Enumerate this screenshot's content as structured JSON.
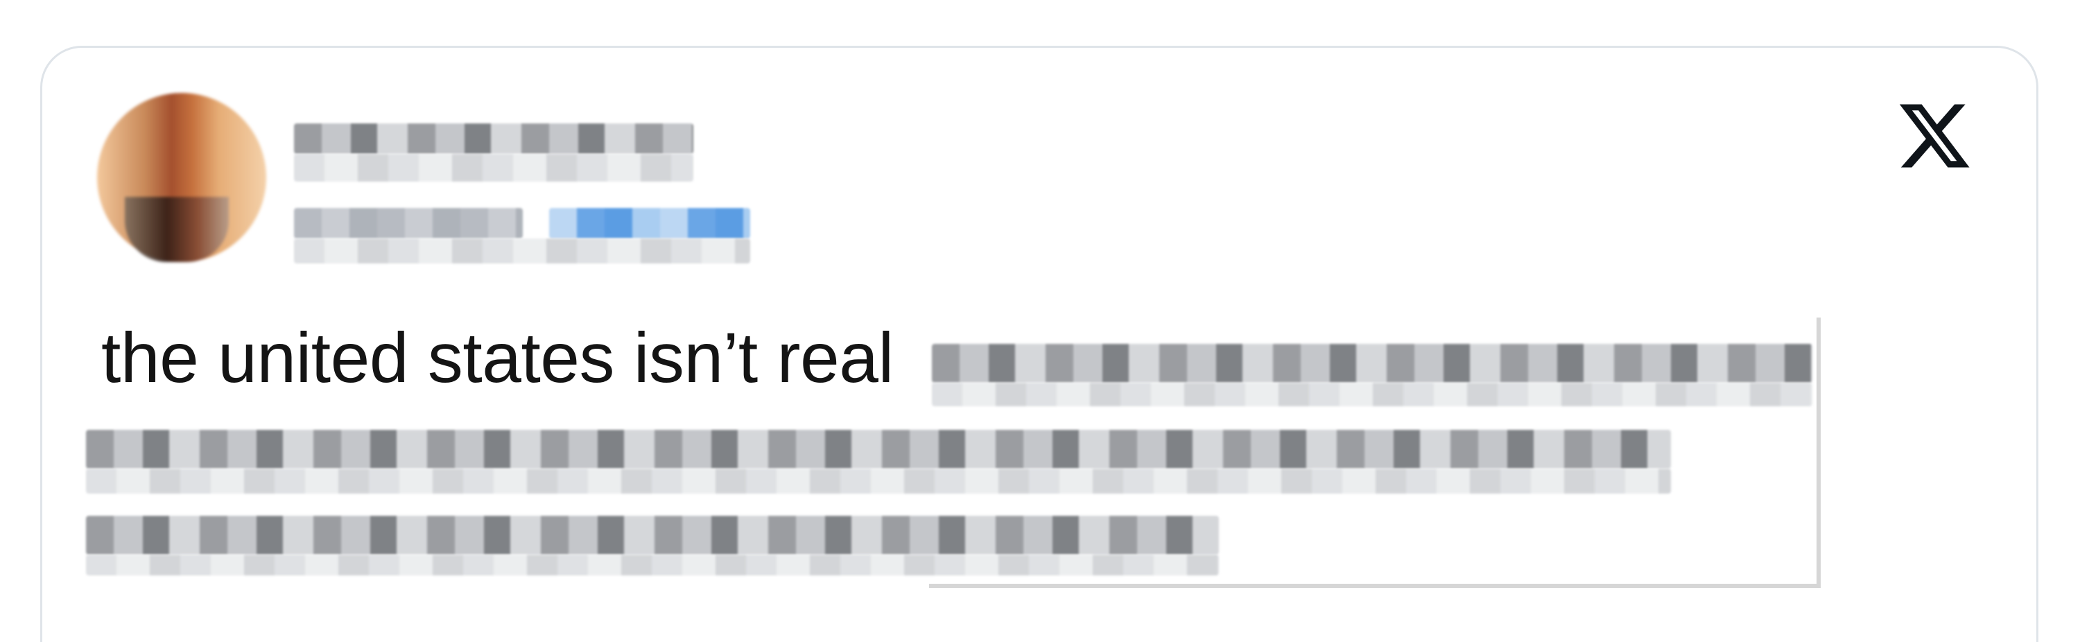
{
  "tweet": {
    "text": "the united states isn’t real"
  },
  "brand": {
    "logo_icon": "x-logo-icon",
    "logo_color": "#0f1419"
  },
  "colors": {
    "card_border": "#dfe4e9",
    "text": "#141414",
    "link_blue": "#5b9de3"
  }
}
